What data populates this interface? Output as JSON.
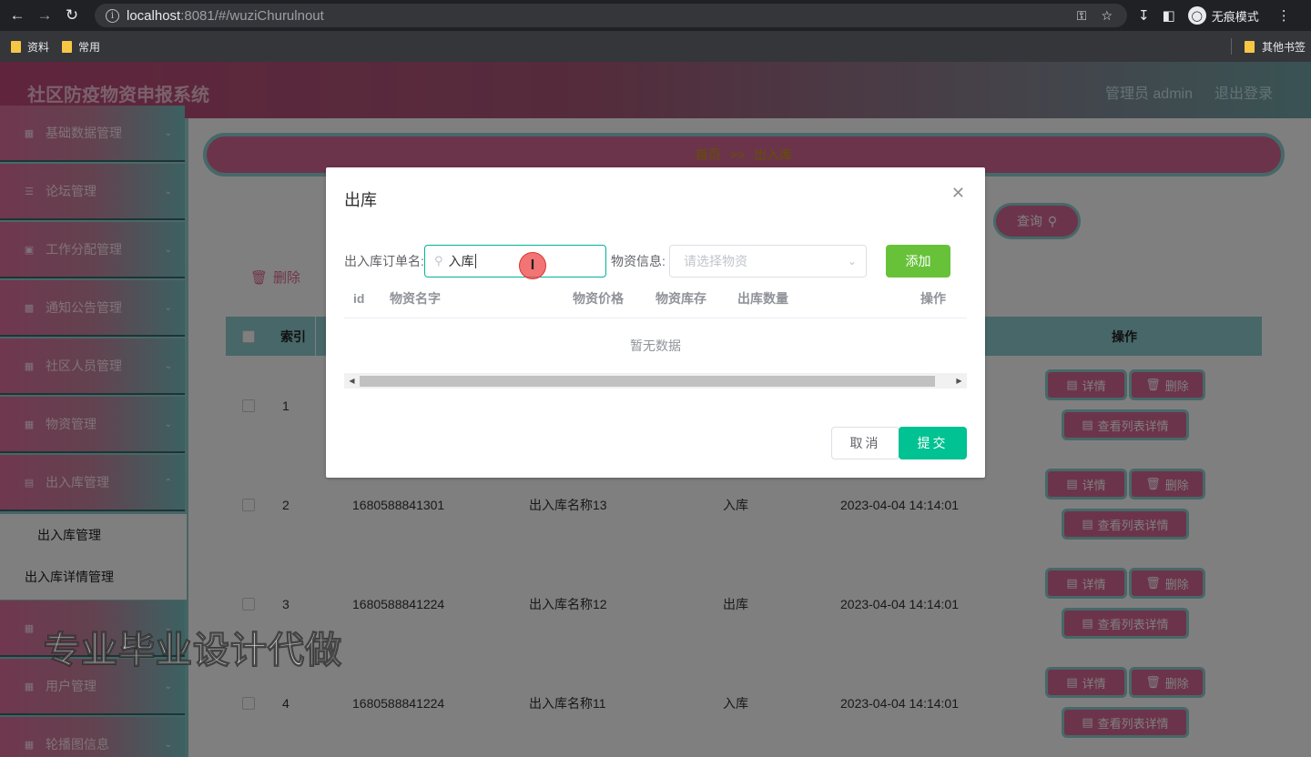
{
  "browser": {
    "url_host": "localhost",
    "url_rest": ":8081/#/wuziChurulnout",
    "profile_label": "无痕模式",
    "bookmarks": [
      "资料",
      "常用"
    ],
    "other_bookmarks": "其他书签"
  },
  "header": {
    "title": "社区防疫物资申报系统",
    "admin": "管理员 admin",
    "logout": "退出登录"
  },
  "sidebar": {
    "items": [
      {
        "label": "基础数据管理",
        "icon": "grid-icon"
      },
      {
        "label": "论坛管理",
        "icon": "list-icon"
      },
      {
        "label": "工作分配管理",
        "icon": "monitor-icon"
      },
      {
        "label": "通知公告管理",
        "icon": "bar-chart-icon"
      },
      {
        "label": "社区人员管理",
        "icon": "grid-icon"
      },
      {
        "label": "物资管理",
        "icon": "grid-icon"
      },
      {
        "label": "出入库管理",
        "icon": "document-icon"
      },
      {
        "label": "用户管理",
        "icon": "grid-icon"
      },
      {
        "label": "轮播图信息",
        "icon": "grid-icon"
      }
    ],
    "submenu": [
      "出入库管理",
      "出入库详情管理"
    ]
  },
  "main": {
    "breadcrumb_home": "首页",
    "breadcrumb_sep": ">>",
    "breadcrumb_current": "出入库",
    "query_label": "查询",
    "delete_label": "删除",
    "table_headers": {
      "index": "索引",
      "actions": "操作"
    },
    "rows": [
      {
        "index": "1",
        "code": "",
        "name": "",
        "type": "",
        "time": ""
      },
      {
        "index": "2",
        "code": "1680588841301",
        "name": "出入库名称13",
        "type": "入库",
        "time": "2023-04-04 14:14:01"
      },
      {
        "index": "3",
        "code": "1680588841224",
        "name": "出入库名称12",
        "type": "出库",
        "time": "2023-04-04 14:14:01"
      },
      {
        "index": "4",
        "code": "1680588841224",
        "name": "出入库名称11",
        "type": "入库",
        "time": "2023-04-04 14:14:01"
      }
    ],
    "row_actions": {
      "detail": "详情",
      "delete": "删除",
      "list_detail": "查看列表详情"
    }
  },
  "dialog": {
    "title": "出库",
    "order_label": "出入库订单名:",
    "order_value": "入库",
    "material_label": "物资信息:",
    "material_placeholder": "请选择物资",
    "add_label": "添加",
    "columns": [
      "id",
      "物资名字",
      "物资价格",
      "物资库存",
      "出库数量",
      "操作"
    ],
    "empty_text": "暂无数据",
    "cancel_label": "取消",
    "submit_label": "提交"
  },
  "watermark": "专业毕业设计代做",
  "colors": {
    "header_pink": "#c04a7a",
    "teal": "#8fcfd0",
    "submit_green": "#00c292",
    "add_green": "#67c23a"
  }
}
